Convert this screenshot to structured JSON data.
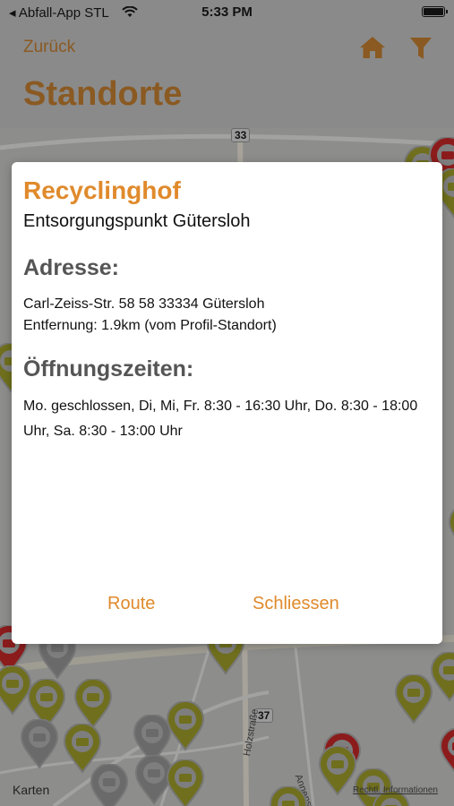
{
  "status_bar": {
    "back_app": "◂ Abfall-App STL",
    "time": "5:33 PM"
  },
  "nav": {
    "back_label": "Zurück",
    "title": "Standorte",
    "accent_color": "#e08a2c"
  },
  "map": {
    "road_labels": [
      "33",
      "37"
    ],
    "street_labels": [
      "Holzstraße",
      "Annenstraße"
    ],
    "footer_left": "Karten",
    "footer_right": "Rechtl. Informationen"
  },
  "modal": {
    "title": "Recyclinghof",
    "subtitle": "Entsorgungspunkt Gütersloh",
    "address_heading": "Adresse:",
    "address_line": "Carl-Zeiss-Str. 58 58 33334 Gütersloh",
    "distance_line": "Entfernung: 1.9km (vom Profil-Standort)",
    "hours_heading": "Öffnungszeiten:",
    "hours_text": "Mo. geschlossen, Di, Mi, Fr. 8:30 - 16:30 Uhr, Do. 8:30 - 18:00 Uhr, Sa. 8:30 - 13:00 Uhr",
    "route_label": "Route",
    "close_label": "Schliessen"
  }
}
